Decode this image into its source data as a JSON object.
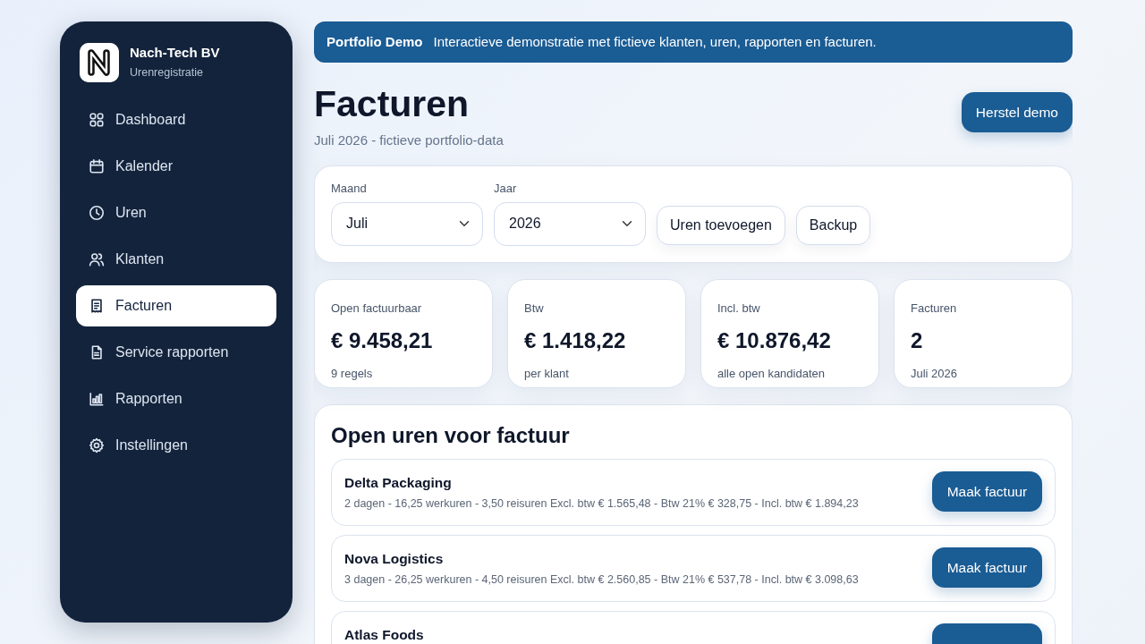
{
  "sidebar": {
    "brand": {
      "name": "Nach-Tech BV",
      "subtitle": "Urenregistratie"
    },
    "items": [
      {
        "label": "Dashboard",
        "selected": false
      },
      {
        "label": "Kalender",
        "selected": false
      },
      {
        "label": "Uren",
        "selected": false
      },
      {
        "label": "Klanten",
        "selected": false
      },
      {
        "label": "Facturen",
        "selected": true
      },
      {
        "label": "Service rapporten",
        "selected": false
      },
      {
        "label": "Rapporten",
        "selected": false
      },
      {
        "label": "Instellingen",
        "selected": false
      }
    ]
  },
  "banner": {
    "title": "Portfolio Demo",
    "text": "Interactieve demonstratie met fictieve klanten, uren, rapporten en facturen."
  },
  "header": {
    "title": "Facturen",
    "subtitle": "Juli 2026 - fictieve portfolio-data",
    "button": "Herstel demo"
  },
  "filters": {
    "fields": [
      {
        "label": "Maand",
        "value": "Juli"
      },
      {
        "label": "Jaar",
        "value": "2026"
      }
    ],
    "buttons": [
      "Uren toevoegen",
      "Backup"
    ]
  },
  "stats": [
    {
      "label": "Open factuurbaar",
      "value": "€ 9.458,21",
      "note": "9 regels"
    },
    {
      "label": "Btw",
      "value": "€ 1.418,22",
      "note": "per klant"
    },
    {
      "label": "Incl. btw",
      "value": "€ 10.876,42",
      "note": "alle open kandidaten"
    },
    {
      "label": "Facturen",
      "value": "2",
      "note": "Juli 2026"
    }
  ],
  "open_hours": {
    "title": "Open uren voor factuur",
    "rows": [
      {
        "client": "Delta Packaging",
        "details": "2 dagen - 16,25 werkuren - 3,50 reisuren Excl. btw € 1.565,48 - Btw 21% € 328,75 - Incl. btw € 1.894,23",
        "button": "Maak factuur"
      },
      {
        "client": "Nova Logistics",
        "details": "3 dagen - 26,25 werkuren - 4,50 reisuren Excl. btw € 2.560,85 - Btw 21% € 537,78 - Incl. btw € 3.098,63",
        "button": "Maak factuur"
      },
      {
        "client": "Atlas Foods"
      }
    ]
  }
}
